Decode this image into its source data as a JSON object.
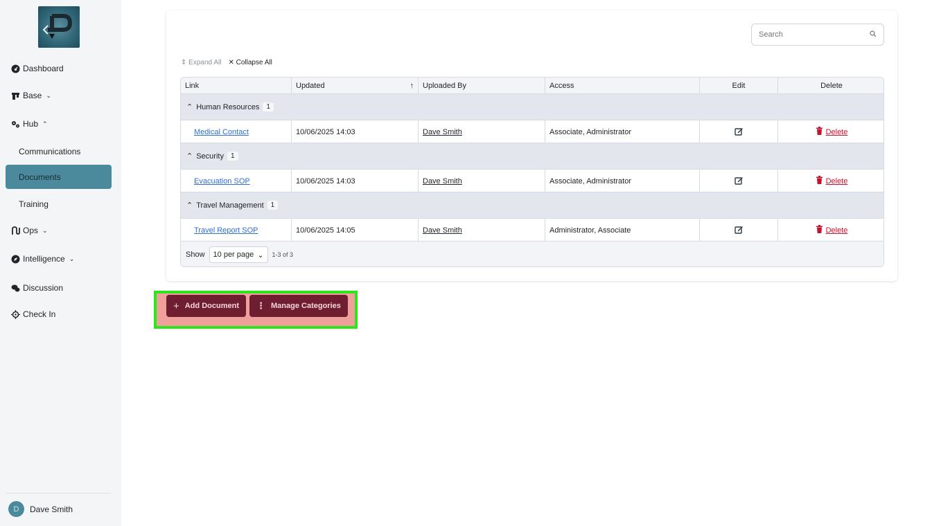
{
  "sidebar": {
    "items": [
      {
        "label": "Dashboard",
        "icon": "dashboard-icon"
      },
      {
        "label": "Base",
        "icon": "building-icon"
      },
      {
        "label": "Hub",
        "icon": "gears-icon"
      },
      {
        "label": "Communications"
      },
      {
        "label": "Documents"
      },
      {
        "label": "Training"
      },
      {
        "label": "Ops",
        "icon": "ops-icon"
      },
      {
        "label": "Intelligence",
        "icon": "compass-icon"
      },
      {
        "label": "Discussion",
        "icon": "chat-icon"
      },
      {
        "label": "Check In",
        "icon": "crosshair-icon"
      }
    ],
    "user": {
      "initial": "D",
      "name": "Dave Smith"
    }
  },
  "toolbar": {
    "search_placeholder": "Search",
    "expand_all": "Expand All",
    "collapse_all": "Collapse All"
  },
  "table": {
    "headers": {
      "link": "Link",
      "updated": "Updated",
      "uploaded_by": "Uploaded By",
      "access": "Access",
      "edit": "Edit",
      "delete": "Delete"
    },
    "groups": [
      {
        "name": "Human Resources",
        "count": "1",
        "rows": [
          {
            "link": "Medical Contact",
            "updated": "10/06/2025 14:03",
            "uploaded_by": "Dave Smith",
            "access": "Associate, Administrator",
            "delete": "Delete"
          }
        ]
      },
      {
        "name": "Security",
        "count": "1",
        "rows": [
          {
            "link": "Evacuation SOP",
            "updated": "10/06/2025 14:03",
            "uploaded_by": "Dave Smith",
            "access": "Associate, Administrator",
            "delete": "Delete"
          }
        ]
      },
      {
        "name": "Travel Management",
        "count": "1",
        "rows": [
          {
            "link": "Travel Report SOP",
            "updated": "10/06/2025 14:05",
            "uploaded_by": "Dave Smith",
            "access": "Administrator, Associate",
            "delete": "Delete"
          }
        ]
      }
    ],
    "footer": {
      "show": "Show",
      "per_page": "10 per page",
      "range": "1-3 of 3"
    }
  },
  "actions": {
    "add_document": "Add Document",
    "manage_categories": "Manage Categories"
  },
  "colors": {
    "accent": "#4a8a9c",
    "button": "#6f1e31",
    "danger": "#c8102e",
    "link": "#2f6fd1",
    "highlight_border": "#2ee41c"
  }
}
